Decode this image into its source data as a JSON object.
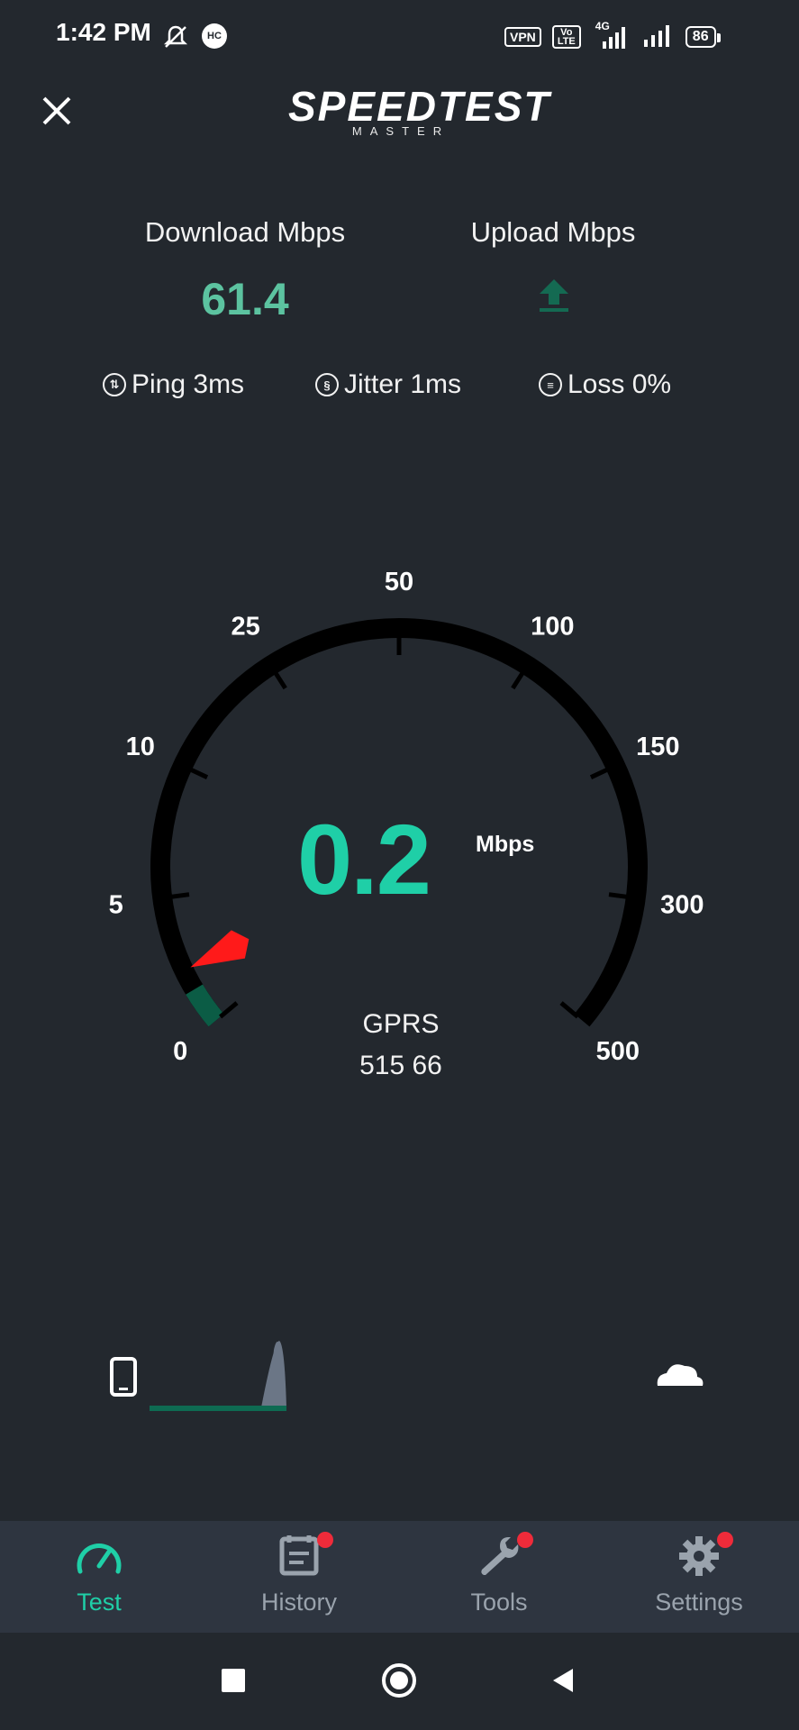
{
  "status_bar": {
    "time": "1:42 PM",
    "vpn": "VPN",
    "volte": "Vo LTE",
    "network": "4G",
    "battery": "86"
  },
  "header": {
    "logo_main": "SPEEDTEST",
    "logo_sub": "MASTER"
  },
  "metrics": {
    "download_label": "Download Mbps",
    "download_value": "61.4",
    "upload_label": "Upload Mbps"
  },
  "stats": {
    "ping": "Ping 3ms",
    "jitter": "Jitter 1ms",
    "loss": "Loss 0%"
  },
  "gauge": {
    "scale_labels": [
      "0",
      "5",
      "10",
      "25",
      "50",
      "100",
      "150",
      "300",
      "500"
    ],
    "current_value": "0.2",
    "current_fraction": 0.035,
    "unit": "Mbps",
    "network_type": "GPRS",
    "network_detail": "515 66"
  },
  "nav": {
    "items": [
      {
        "label": "Test",
        "active": true
      },
      {
        "label": "History",
        "active": false
      },
      {
        "label": "Tools",
        "active": false
      },
      {
        "label": "Settings",
        "active": false
      }
    ]
  },
  "colors": {
    "background": "#23282e",
    "accent": "#1fcfa7",
    "download": "#5cc3a0",
    "needle": "#ff1a1a",
    "gauge_progress": "#0b5c45",
    "nav_bg": "#2e3540",
    "nav_inactive": "#9aa3ad",
    "badge": "#ef2b3a"
  }
}
